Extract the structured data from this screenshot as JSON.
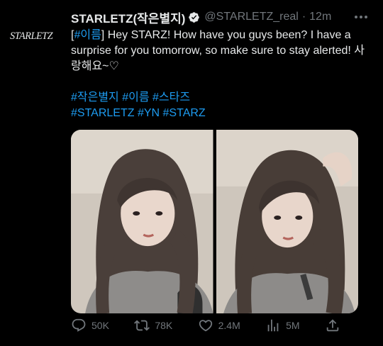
{
  "author": {
    "avatar_text": "STARLETZ",
    "display_name": "STARLETZ(작은별지)",
    "handle": "@STARLETZ_real",
    "separator": "·",
    "time": "12m"
  },
  "tweet": {
    "line1_prefix_open": "[",
    "line1_tag": "#이름",
    "line1_rest": "] Hey STARZ! How have you guys been? I have a surprise for you tomorrow, so make sure to stay alerted! 사랑해요~♡",
    "hashtags_line1": [
      "#작은별지",
      "#이름",
      "#스타즈"
    ],
    "hashtags_line2": [
      "#STARLETZ",
      "#YN",
      "#STARZ"
    ]
  },
  "media": [
    {
      "icon": "photo-portrait-left"
    },
    {
      "icon": "photo-portrait-right"
    }
  ],
  "actions": {
    "replies": "50K",
    "retweets": "78K",
    "likes": "2.4M",
    "views": "5M"
  },
  "colors": {
    "background": "#000000",
    "text": "#e7e9ea",
    "secondary": "#71767b",
    "link": "#1d9bf0"
  }
}
